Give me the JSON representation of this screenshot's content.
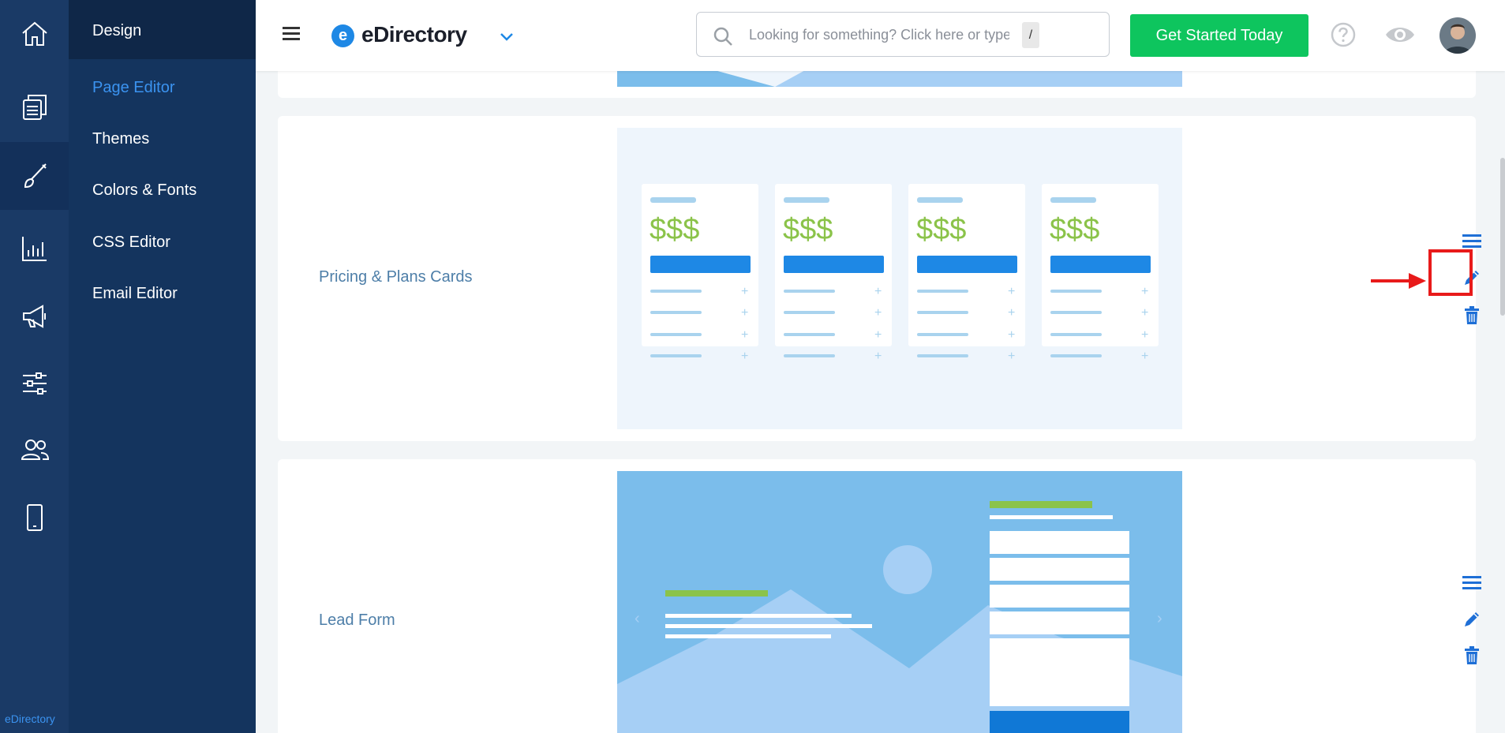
{
  "rail": {
    "items": [
      {
        "icon": "home-icon"
      },
      {
        "icon": "pages-icon"
      },
      {
        "icon": "brush-icon",
        "active": true
      },
      {
        "icon": "chart-icon"
      },
      {
        "icon": "megaphone-icon"
      },
      {
        "icon": "sliders-icon"
      },
      {
        "icon": "users-icon"
      },
      {
        "icon": "mobile-icon"
      }
    ],
    "brand": "eDirectory"
  },
  "submenu": {
    "title": "Design",
    "items": [
      {
        "label": "Page Editor",
        "active": true
      },
      {
        "label": "Themes"
      },
      {
        "label": "Colors & Fonts"
      },
      {
        "label": "CSS Editor"
      },
      {
        "label": "Email Editor"
      }
    ]
  },
  "header": {
    "logo_letter": "e",
    "logo_text": "eDirectory",
    "search_placeholder": "Looking for something? Click here or type",
    "search_shortcut": "/",
    "cta_label": "Get Started Today"
  },
  "sections": [
    {
      "label": "Pricing & Plans Cards",
      "preview": {
        "card_count": 4,
        "price_text": "$$$",
        "row_symbol": "+"
      }
    },
    {
      "label": "Lead Form",
      "preview": {
        "carousel_prev": "‹",
        "carousel_next": "›"
      }
    }
  ],
  "colors": {
    "rail_bg": "#1a3a66",
    "submenu_bg": "#14345e",
    "accent_blue": "#3b93f0",
    "cta_green": "#0ec55e",
    "price_green": "#8bc34a",
    "highlight_red": "#e81a1a"
  }
}
